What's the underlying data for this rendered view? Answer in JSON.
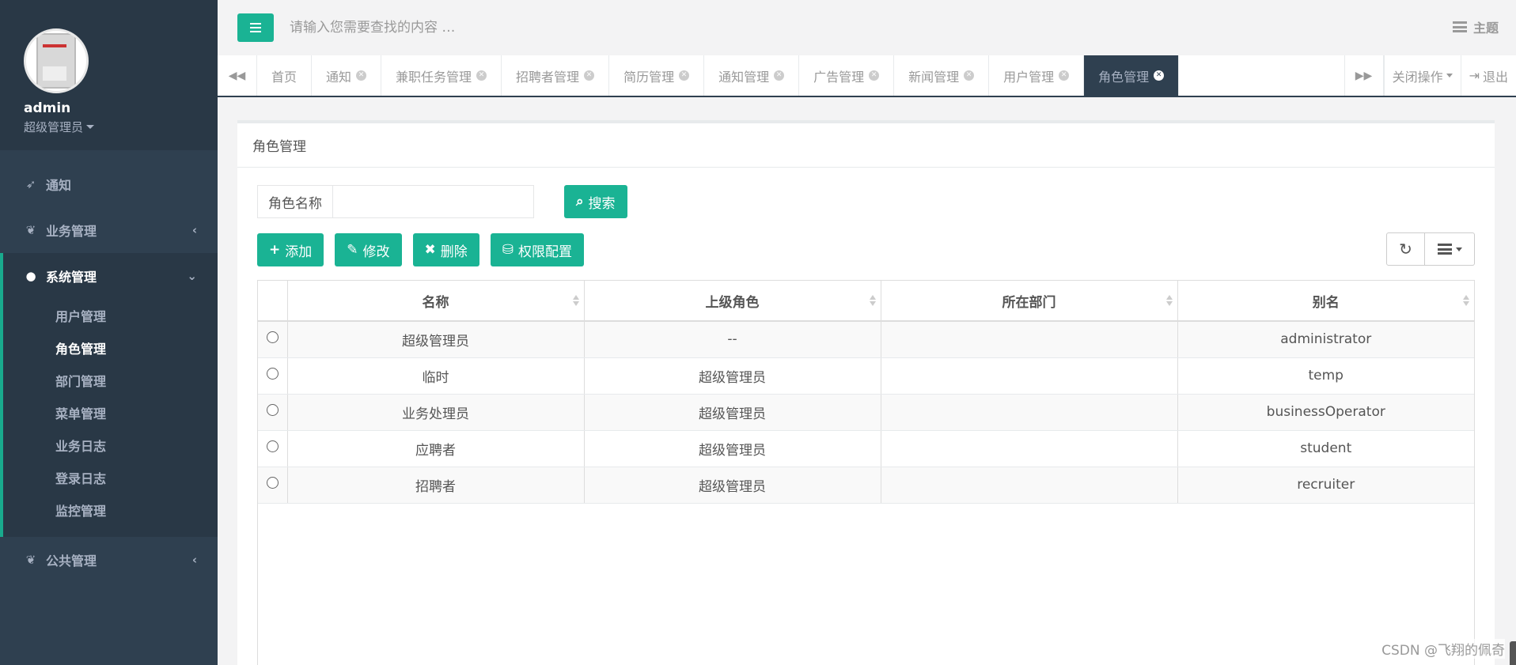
{
  "colors": {
    "accent": "#1ab394",
    "sidebar": "#2f4050",
    "sidebar_dark": "#293846"
  },
  "profile": {
    "name": "admin",
    "role": "超级管理员"
  },
  "nav": {
    "notice": "通知",
    "business": "业务管理",
    "system": "系统管理",
    "system_items": [
      "用户管理",
      "角色管理",
      "部门管理",
      "菜单管理",
      "业务日志",
      "登录日志",
      "监控管理"
    ],
    "public": "公共管理"
  },
  "header": {
    "search_placeholder": "请输入您需要查找的内容 …",
    "theme_label": "主题"
  },
  "tabs": {
    "items": [
      "首页",
      "通知",
      "兼职任务管理",
      "招聘者管理",
      "简历管理",
      "通知管理",
      "广告管理",
      "新闻管理",
      "用户管理",
      "角色管理"
    ],
    "active": "角色管理",
    "close_ops": "关闭操作",
    "logout": "退出"
  },
  "panel": {
    "title": "角色管理",
    "search_label": "角色名称",
    "search_value": "",
    "search_button": "搜索",
    "buttons": {
      "add": "添加",
      "edit": "修改",
      "delete": "删除",
      "perm": "权限配置"
    }
  },
  "table": {
    "headers": [
      "名称",
      "上级角色",
      "所在部门",
      "别名"
    ],
    "rows": [
      [
        "超级管理员",
        "--",
        "",
        "administrator"
      ],
      [
        "临时",
        "超级管理员",
        "",
        "temp"
      ],
      [
        "业务处理员",
        "超级管理员",
        "",
        "businessOperator"
      ],
      [
        "应聘者",
        "超级管理员",
        "",
        "student"
      ],
      [
        "招聘者",
        "超级管理员",
        "",
        "recruiter"
      ]
    ]
  },
  "watermark": "CSDN @飞翔的佩奇"
}
